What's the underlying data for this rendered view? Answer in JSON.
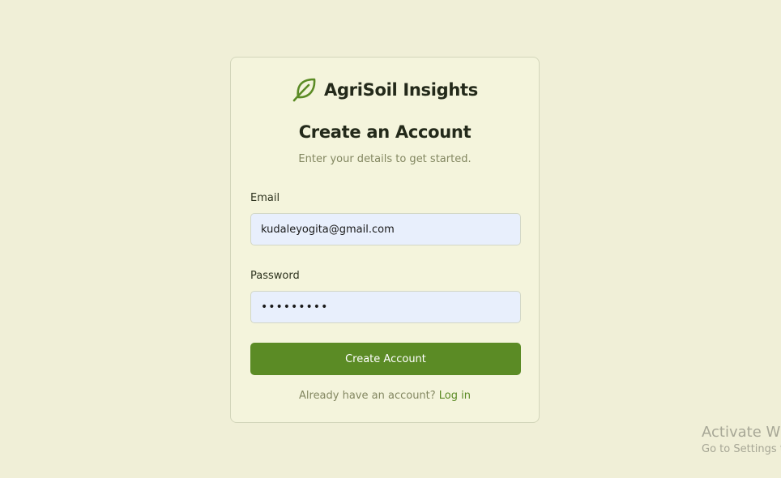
{
  "brand": {
    "name": "AgriSoil Insights",
    "icon": "leaf-icon",
    "color": "#5b8b25"
  },
  "form": {
    "title": "Create an Account",
    "subtitle": "Enter your details to get started.",
    "email": {
      "label": "Email",
      "value": "kudaleyogita@gmail.com"
    },
    "password": {
      "label": "Password",
      "value": "yogita123"
    },
    "submit_label": "Create Account",
    "footer_text": "Already have an account? ",
    "login_link": "Log in"
  },
  "watermark": {
    "title": "Activate Windows",
    "subtitle": "Go to Settings to activate Windows."
  },
  "colors": {
    "background": "#f0efd7",
    "card": "#f4f4dc",
    "accent": "#5b8b25",
    "input_fill": "#e8effc"
  }
}
